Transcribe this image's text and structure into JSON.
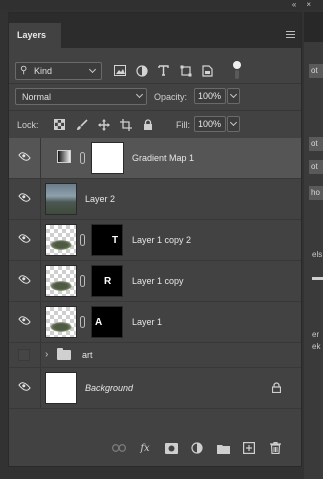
{
  "top_buttons": {
    "collapse": "«",
    "close": "×"
  },
  "panel": {
    "tab_label": "Layers",
    "menu_icon": "hamburger-menu-icon"
  },
  "filter": {
    "kind_label": "Kind",
    "icons": [
      "image-filter-icon",
      "adjustment-filter-icon",
      "type-filter-icon",
      "shape-filter-icon",
      "smart-object-filter-icon"
    ]
  },
  "blend": {
    "mode": "Normal",
    "opacity_label": "Opacity:",
    "opacity_value": "100%"
  },
  "locks": {
    "label": "Lock:",
    "fill_label": "Fill:",
    "fill_value": "100%"
  },
  "layers": [
    {
      "name": "Gradient Map 1",
      "visible": true,
      "selected": true,
      "type": "adjustment"
    },
    {
      "name": "Layer 2",
      "visible": true,
      "type": "photo"
    },
    {
      "name": "Layer 1 copy 2",
      "visible": true,
      "type": "masked",
      "mask_letter": "T"
    },
    {
      "name": "Layer 1 copy",
      "visible": true,
      "type": "masked",
      "mask_letter": "R"
    },
    {
      "name": "Layer 1",
      "visible": true,
      "type": "masked",
      "mask_letter": "A"
    },
    {
      "name": "art",
      "visible": false,
      "type": "group"
    },
    {
      "name": "Background",
      "visible": true,
      "type": "background",
      "locked": true
    }
  ],
  "footer_icons": [
    "link-layers-icon",
    "fx-icon",
    "add-mask-icon",
    "new-adjustment-icon",
    "new-group-icon",
    "new-layer-icon",
    "delete-layer-icon"
  ],
  "sliver_panel": {
    "rows": [
      "ot",
      "ot",
      "ot",
      "ho"
    ],
    "texts": [
      "els",
      "er",
      "ek"
    ]
  }
}
